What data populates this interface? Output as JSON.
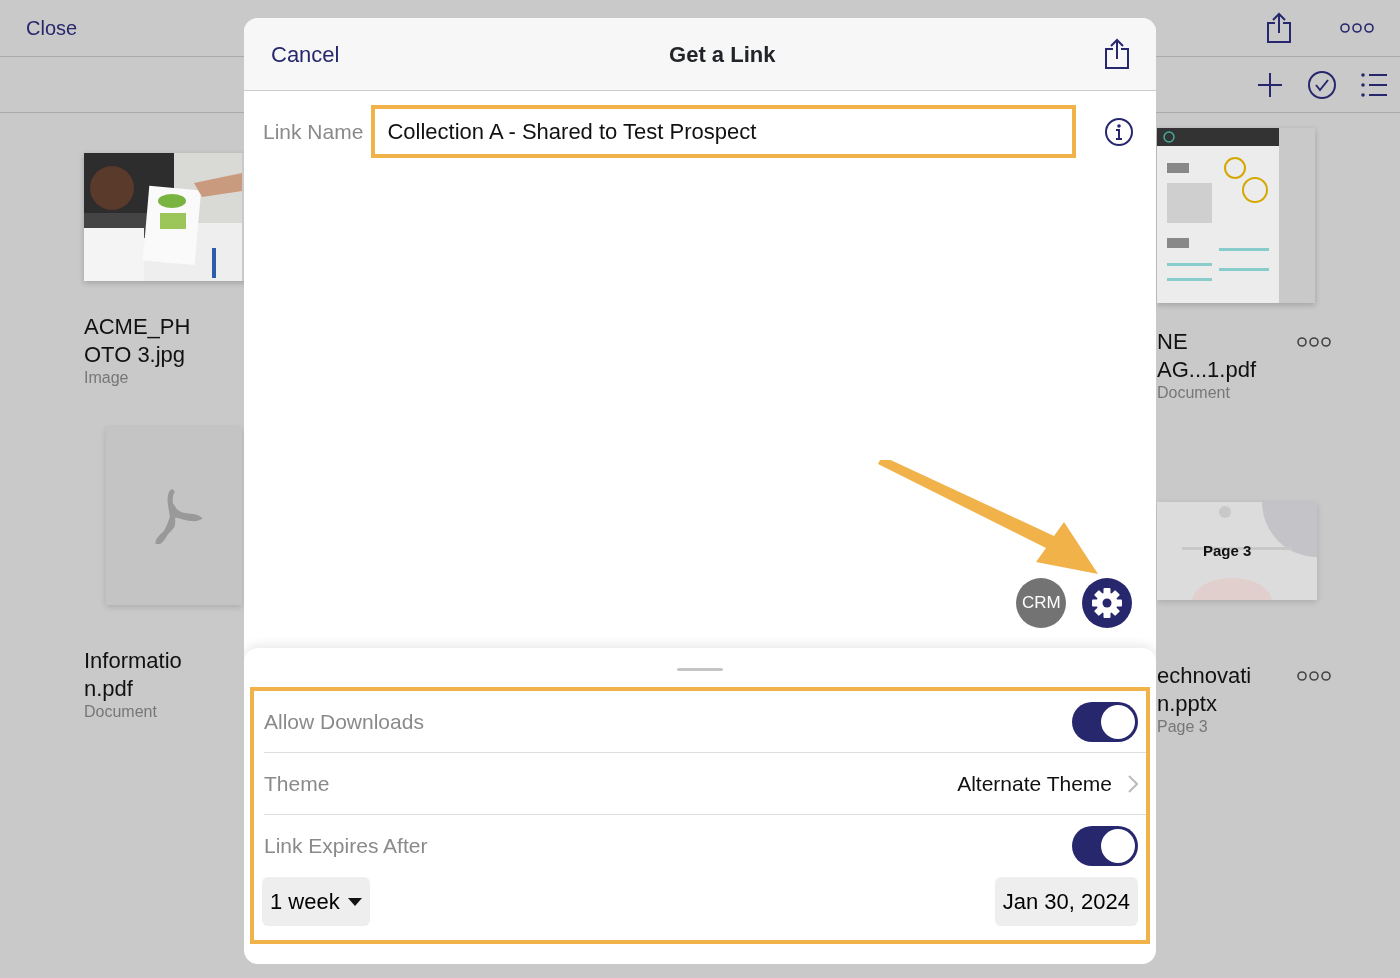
{
  "background": {
    "close_label": "Close",
    "left_files": [
      {
        "name_lines": [
          "ACME_PH",
          "OTO 3.jpg"
        ],
        "type": "Image",
        "kind": "picture"
      },
      {
        "name_lines": [
          "Informatio",
          "n.pdf"
        ],
        "type": "Document",
        "kind": "pdf"
      }
    ],
    "right_files": [
      {
        "name_lines": [
          "NE",
          "AG...1.pdf"
        ],
        "type": "Document",
        "kind": "picture"
      },
      {
        "name_lines": [
          "echnovati",
          "n.pptx"
        ],
        "type": "Page 3",
        "kind": "slide",
        "thumb_label": "Page 3"
      }
    ]
  },
  "dialog": {
    "cancel": "Cancel",
    "title": "Get a Link",
    "link_name_label": "Link Name",
    "link_name_value": "Collection A - Shared to Test Prospect",
    "crm_label": "CRM",
    "settings": [
      {
        "kind": "toggle",
        "label": "Allow Downloads",
        "on": true
      },
      {
        "kind": "link",
        "label": "Theme",
        "value": "Alternate Theme"
      },
      {
        "kind": "toggle",
        "label": "Link Expires After",
        "on": true
      }
    ],
    "duration": "1 week",
    "expiry_date": "Jan 30, 2024"
  }
}
